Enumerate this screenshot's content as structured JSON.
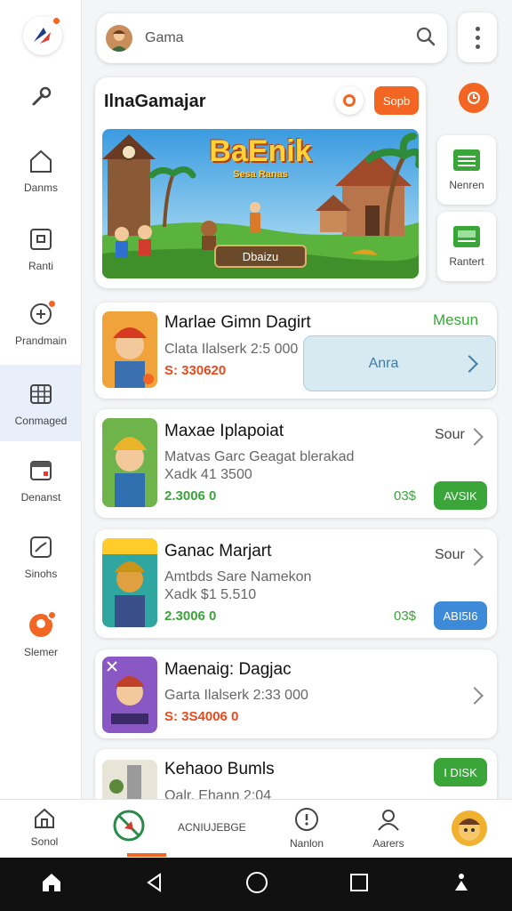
{
  "search": {
    "text": "Gama"
  },
  "sidebar": {
    "items": [
      {
        "label": "",
        "icon": "wrench-icon"
      },
      {
        "label": "Danms",
        "icon": "home-icon"
      },
      {
        "label": "Ranti",
        "icon": "image-icon"
      },
      {
        "label": "Prandmain",
        "icon": "gamepad-icon"
      },
      {
        "label": "Conmaged",
        "icon": "grid-icon"
      },
      {
        "label": "Denanst",
        "icon": "calendar-icon"
      },
      {
        "label": "Sinohs",
        "icon": "chart-icon"
      },
      {
        "label": "Slemer",
        "icon": "profile-orange-icon"
      }
    ]
  },
  "featured": {
    "title": "IlnaGamajar",
    "button": "Sopb",
    "banner_title": "BaEnik",
    "banner_subtitle": "Sesa Ranas",
    "banner_button": "Dbaizu"
  },
  "side_cards": [
    {
      "label": "Nenren"
    },
    {
      "label": "Rantert"
    }
  ],
  "games": [
    {
      "title": "Marlae Gimn Dagirt",
      "subtitle": "Clata Ilalserk 2:5 000",
      "price": "S: 330620",
      "tag": "Mesun",
      "overlay": "Anra"
    },
    {
      "title": "Maxae Iplapoiat",
      "subtitle": "Matvas Garc Geagat blerakad",
      "meta": "Xadk 41 3500",
      "price": "2.3006 0",
      "tag": "Sour",
      "side_value": "03$",
      "button": "AVSIK"
    },
    {
      "title": "Ganac Marjart",
      "subtitle": "Amtbds Sare Namekon",
      "meta": "Xadk $1 5.510",
      "price": "2.3006 0",
      "tag": "Sour",
      "side_value": "03$",
      "button": "ABI5I6"
    },
    {
      "title": "Maenaig: Dagjac",
      "subtitle": "Garta Ilalserk 2:33 000",
      "price": "S: 3S4006 0"
    },
    {
      "title": "Kehaoo Bumls",
      "subtitle": "Oalr. Ehann 2:04",
      "button": "I DISK"
    }
  ],
  "bottom_nav": [
    {
      "label": "Sonol",
      "icon": "home-outline-icon"
    },
    {
      "label": "",
      "icon": "no-game-icon"
    },
    {
      "label": "ACNIUJEBGE",
      "icon": ""
    },
    {
      "label": "Nanlon",
      "icon": "location-icon"
    },
    {
      "label": "Aarers",
      "icon": "person-icon"
    },
    {
      "label": "",
      "icon": "avatar-icon"
    }
  ],
  "colors": {
    "accent": "#f26522",
    "green": "#3aa63a",
    "blue": "#3d8bd8"
  }
}
